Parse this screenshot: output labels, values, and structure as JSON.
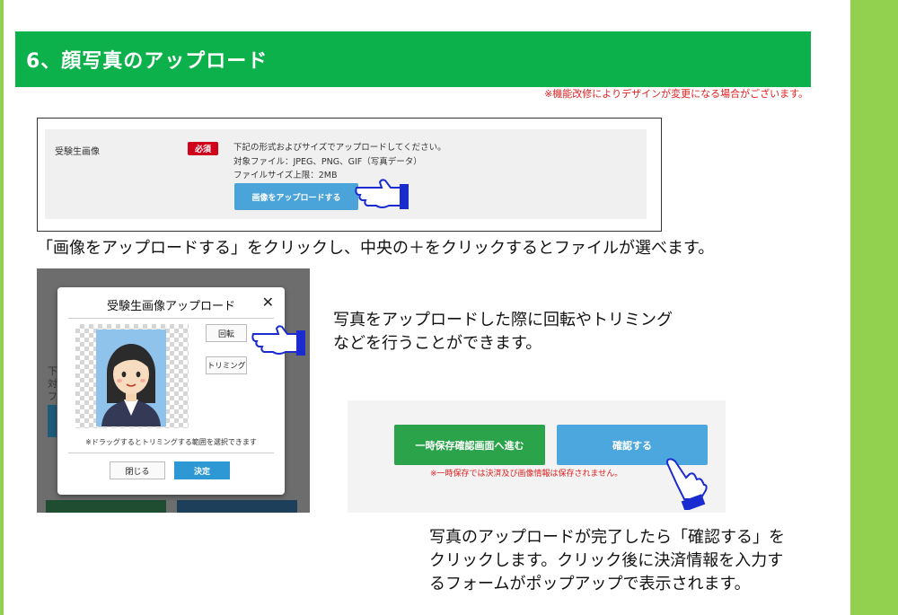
{
  "section": {
    "title": "6、顔写真のアップロード",
    "notice": "※機能改修によりデザインが変更になる場合がございます。"
  },
  "upload_form": {
    "label": "受験生画像",
    "required_badge": "必須",
    "desc_line1": "下記の形式およびサイズでアップロードしてください。",
    "desc_line2": "対象ファイル：JPEG、PNG、GIF（写真データ）",
    "desc_line3": "ファイルサイズ上限：2MB",
    "upload_button": "画像をアップロードする"
  },
  "caption_upload": "「画像をアップロードする」をクリックし、中央の＋をクリックするとファイルが選べます。",
  "modal": {
    "bg_fragments": [
      "下",
      "対",
      "フ"
    ],
    "title": "受験生画像アップロード",
    "close_glyph": "✕",
    "rotate_button": "回転",
    "trim_button": "トリミング",
    "hint": "※ドラッグするとトリミングする範囲を選択できます",
    "close_button": "閉じる",
    "decide_button": "決定"
  },
  "caption_rotate": {
    "line1": "写真をアップロードした際に回転やトリミング",
    "line2": "などを行うことができます。"
  },
  "confirm_panel": {
    "temp_save_button": "一時保存確認画面へ進む",
    "confirm_button": "確認する",
    "note": "※一時保存では決済及び画像情報は保存されません。"
  },
  "caption_confirm": {
    "line1": "写真のアップロードが完了したら「確認する」を",
    "line2": "クリックします。クリック後に決済情報を入力す",
    "line3": "るフォームがポップアップで表示されます。"
  },
  "colors": {
    "header_green": "#0cb14b",
    "side_stripe": "#92d050",
    "button_blue": "#4aa3d9",
    "button_green": "#2aa34a",
    "required_red": "#d0021b",
    "note_red": "#e02020",
    "pointer_blue": "#1a2bd0"
  }
}
